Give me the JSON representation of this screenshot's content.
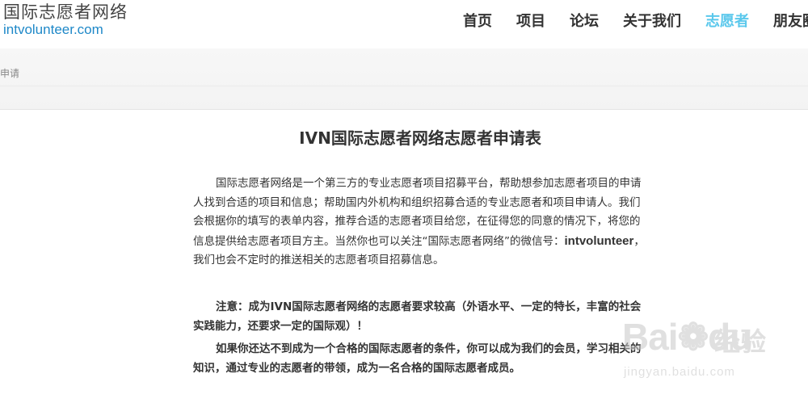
{
  "header": {
    "logo_cn": "国际志愿者网络",
    "logo_en": "intvolunteer.com",
    "nav": [
      "首页",
      "项目",
      "论坛",
      "关于我们",
      "志愿者",
      "朋友圈"
    ],
    "active_nav": "志愿者",
    "active_color": "#5bc8ec"
  },
  "breadcrumb": "申请",
  "main": {
    "title": "IVN国际志愿者网络志愿者申请表",
    "intro_text": "国际志愿者网络是一个第三方的专业志愿者项目招募平台，帮助想参加志愿者项目的申请人找到合适的项目和信息；帮助国内外机构和组织招募合适的专业志愿者和项目申请人。我们会根据你的填写的表单内容，推荐合适的志愿者项目给您，在征得您的同意的情况下，将您的信息提供给志愿者项目方主。当然你也可以关注“国际志愿者网络”的微信号：",
    "wechat_id": "intvolunteer",
    "intro_tail": "，我们也会不定时的推送相关的志愿者项目招募信息。",
    "note_1": "注意：成为IVN国际志愿者网络的志愿者要求较高（外语水平、一定的特长，丰富的社会实践能力，还要求一定的国际观）！",
    "note_2": "如果你还达不到成为一个合格的国际志愿者的条件，你可以成为我们的会员，学习相关的知识，通过专业的志愿者的带领，成为一名合格的国际志愿者成员。"
  },
  "watermark": {
    "logo": "Baidu",
    "label": "经验",
    "url": "jingyan.baidu.com"
  }
}
